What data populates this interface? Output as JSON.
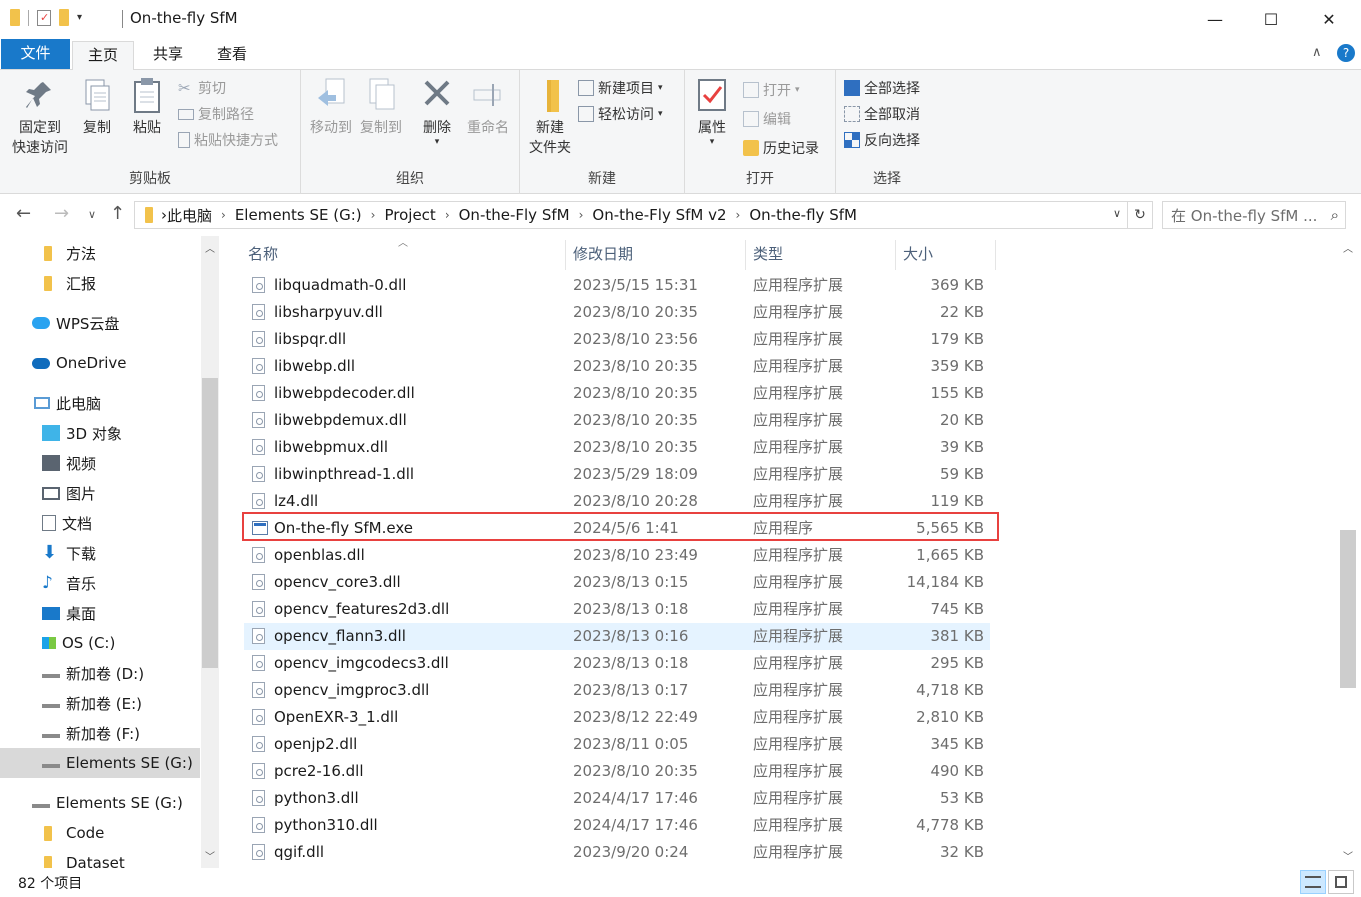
{
  "window": {
    "title": "On-the-fly SfM",
    "minimize": "—",
    "maximize": "☐",
    "close": "✕"
  },
  "tabs": {
    "file": "文件",
    "home": "主页",
    "share": "共享",
    "view": "查看"
  },
  "ribbon": {
    "clipboard": {
      "label": "剪贴板",
      "pin": [
        "固定到",
        "快速访问"
      ],
      "copy": "复制",
      "paste": "粘贴",
      "cut": "剪切",
      "copy_path": "复制路径",
      "paste_shortcut": "粘贴快捷方式"
    },
    "organize": {
      "label": "组织",
      "move_to": "移动到",
      "copy_to": "复制到",
      "delete": "删除",
      "rename": "重命名"
    },
    "new": {
      "label": "新建",
      "new_folder": [
        "新建",
        "文件夹"
      ],
      "new_item": "新建项目",
      "easy_access": "轻松访问"
    },
    "open": {
      "label": "打开",
      "properties": "属性",
      "open": "打开",
      "edit": "编辑",
      "history": "历史记录"
    },
    "select": {
      "label": "选择",
      "select_all": "全部选择",
      "select_none": "全部取消",
      "invert": "反向选择"
    }
  },
  "address": {
    "crumbs": [
      "此电脑",
      "Elements SE (G:)",
      "Project",
      "On-the-Fly SfM",
      "On-the-Fly SfM v2",
      "On-the-fly SfM"
    ],
    "search_placeholder": "在 On-the-fly SfM ..."
  },
  "nav": {
    "items": [
      {
        "label": "方法",
        "icon": "folder-icon"
      },
      {
        "label": "汇报",
        "icon": "folder-icon"
      },
      {
        "label": "WPS云盘",
        "icon": "cloud-icon"
      },
      {
        "label": "OneDrive",
        "icon": "onedrive-icon"
      },
      {
        "label": "此电脑",
        "icon": "computer-icon"
      },
      {
        "label": "3D 对象",
        "icon": "cube-icon"
      },
      {
        "label": "视频",
        "icon": "video-icon"
      },
      {
        "label": "图片",
        "icon": "picture-icon"
      },
      {
        "label": "文档",
        "icon": "document-icon"
      },
      {
        "label": "下载",
        "icon": "download-icon"
      },
      {
        "label": "音乐",
        "icon": "music-icon"
      },
      {
        "label": "桌面",
        "icon": "desktop-icon"
      },
      {
        "label": "OS (C:)",
        "icon": "drive-icon"
      },
      {
        "label": "新加卷 (D:)",
        "icon": "drive-icon"
      },
      {
        "label": "新加卷 (E:)",
        "icon": "drive-icon"
      },
      {
        "label": "新加卷 (F:)",
        "icon": "drive-icon"
      },
      {
        "label": "Elements SE (G:)",
        "icon": "drive-icon"
      },
      {
        "label": "Elements SE (G:)",
        "icon": "drive-icon"
      },
      {
        "label": "Code",
        "icon": "folder-icon"
      },
      {
        "label": "Dataset",
        "icon": "folder-icon"
      }
    ]
  },
  "columns": {
    "name": "名称",
    "date": "修改日期",
    "type": "类型",
    "size": "大小"
  },
  "files": [
    {
      "name": "libquadmath-0.dll",
      "date": "2023/5/15 15:31",
      "type": "应用程序扩展",
      "size": "369 KB"
    },
    {
      "name": "libsharpyuv.dll",
      "date": "2023/8/10 20:35",
      "type": "应用程序扩展",
      "size": "22 KB"
    },
    {
      "name": "libspqr.dll",
      "date": "2023/8/10 23:56",
      "type": "应用程序扩展",
      "size": "179 KB"
    },
    {
      "name": "libwebp.dll",
      "date": "2023/8/10 20:35",
      "type": "应用程序扩展",
      "size": "359 KB"
    },
    {
      "name": "libwebpdecoder.dll",
      "date": "2023/8/10 20:35",
      "type": "应用程序扩展",
      "size": "155 KB"
    },
    {
      "name": "libwebpdemux.dll",
      "date": "2023/8/10 20:35",
      "type": "应用程序扩展",
      "size": "20 KB"
    },
    {
      "name": "libwebpmux.dll",
      "date": "2023/8/10 20:35",
      "type": "应用程序扩展",
      "size": "39 KB"
    },
    {
      "name": "libwinpthread-1.dll",
      "date": "2023/5/29 18:09",
      "type": "应用程序扩展",
      "size": "59 KB"
    },
    {
      "name": "lz4.dll",
      "date": "2023/8/10 20:28",
      "type": "应用程序扩展",
      "size": "119 KB"
    },
    {
      "name": "On-the-fly SfM.exe",
      "date": "2024/5/6 1:41",
      "type": "应用程序",
      "size": "5,565 KB"
    },
    {
      "name": "openblas.dll",
      "date": "2023/8/10 23:49",
      "type": "应用程序扩展",
      "size": "1,665 KB"
    },
    {
      "name": "opencv_core3.dll",
      "date": "2023/8/13 0:15",
      "type": "应用程序扩展",
      "size": "14,184 KB"
    },
    {
      "name": "opencv_features2d3.dll",
      "date": "2023/8/13 0:18",
      "type": "应用程序扩展",
      "size": "745 KB"
    },
    {
      "name": "opencv_flann3.dll",
      "date": "2023/8/13 0:16",
      "type": "应用程序扩展",
      "size": "381 KB"
    },
    {
      "name": "opencv_imgcodecs3.dll",
      "date": "2023/8/13 0:18",
      "type": "应用程序扩展",
      "size": "295 KB"
    },
    {
      "name": "opencv_imgproc3.dll",
      "date": "2023/8/13 0:17",
      "type": "应用程序扩展",
      "size": "4,718 KB"
    },
    {
      "name": "OpenEXR-3_1.dll",
      "date": "2023/8/12 22:49",
      "type": "应用程序扩展",
      "size": "2,810 KB"
    },
    {
      "name": "openjp2.dll",
      "date": "2023/8/11 0:05",
      "type": "应用程序扩展",
      "size": "345 KB"
    },
    {
      "name": "pcre2-16.dll",
      "date": "2023/8/10 20:35",
      "type": "应用程序扩展",
      "size": "490 KB"
    },
    {
      "name": "python3.dll",
      "date": "2024/4/17 17:46",
      "type": "应用程序扩展",
      "size": "53 KB"
    },
    {
      "name": "python310.dll",
      "date": "2024/4/17 17:46",
      "type": "应用程序扩展",
      "size": "4,778 KB"
    },
    {
      "name": "qgif.dll",
      "date": "2023/9/20 0:24",
      "type": "应用程序扩展",
      "size": "32 KB"
    }
  ],
  "status": {
    "count": "82 个项目"
  },
  "colors": {
    "accent": "#1979ca",
    "highlight_box": "#e8413f",
    "hover_row": "#e5f3ff"
  }
}
